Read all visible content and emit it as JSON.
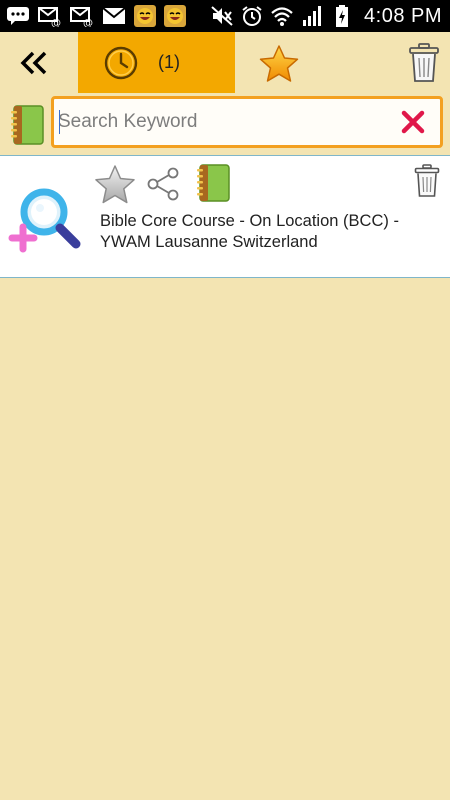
{
  "status_bar": {
    "time": "4:08 PM",
    "left_icons": [
      "chat-icon",
      "email-icon",
      "email-icon",
      "mail-icon",
      "emoji-icon",
      "emoji-icon"
    ],
    "right_icons": [
      "mute-icon",
      "alarm-icon",
      "wifi-icon",
      "signal-icon",
      "battery-icon"
    ]
  },
  "toolbar": {
    "back_icon": "double-chevron-left-icon",
    "history": {
      "icon": "clock-icon",
      "count": "(1)",
      "active_color": "#f3a800"
    },
    "favorites_icon": "star-icon",
    "trash_icon": "trash-icon"
  },
  "search": {
    "placeholder": "Search Keyword",
    "value": "",
    "left_icon": "book-icon",
    "clear_icon": "close-icon",
    "border_color": "#f3a020"
  },
  "results": [
    {
      "title": "Bible Core Course - On Location (BCC) - YWAM Lausanne Switzerland",
      "logo_icon": "magnifier-plus-logo",
      "actions": [
        "star-icon",
        "share-icon",
        "book-icon",
        "trash-icon"
      ]
    }
  ],
  "colors": {
    "background": "#f3e4b2",
    "accent": "#f3a800",
    "divider": "#7fb6c9",
    "clear_red": "#e0184a"
  }
}
